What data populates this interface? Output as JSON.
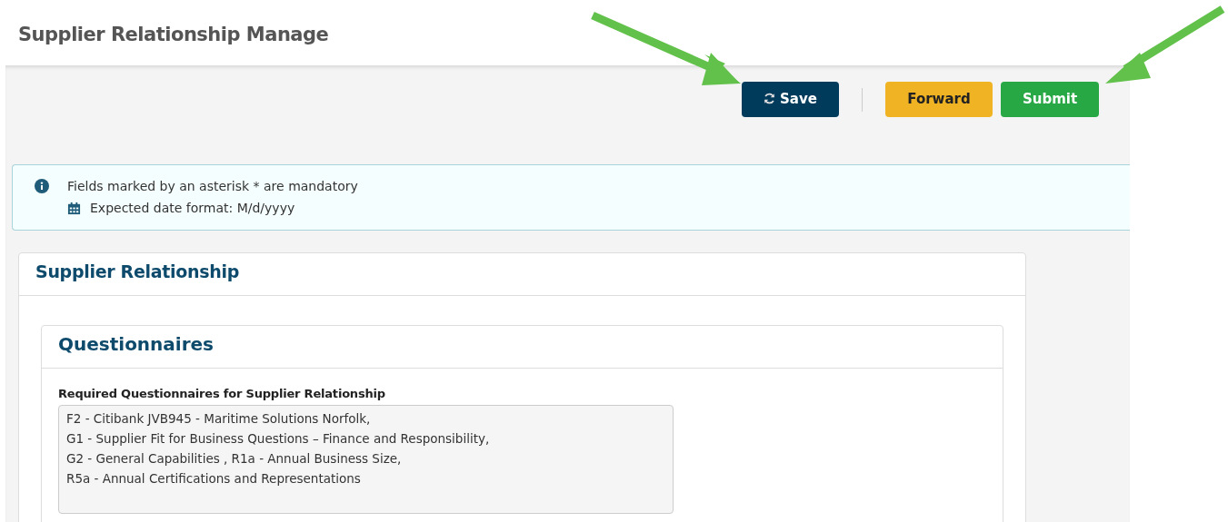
{
  "page": {
    "title": "Supplier Relationship Manage"
  },
  "toolbar": {
    "buttons": [
      {
        "label": "Save",
        "kind": "primary",
        "has_icon": true
      },
      {
        "label": "Forward",
        "kind": "warning",
        "has_icon": false
      },
      {
        "label": "Submit",
        "kind": "success",
        "has_icon": false
      }
    ]
  },
  "notice": {
    "lines": [
      {
        "text": "Fields marked by an asterisk * are mandatory",
        "kind": "info"
      },
      {
        "text": "Expected date format: M/d/yyyy",
        "kind": "calendar"
      }
    ]
  },
  "section": {
    "title": "Supplier Relationship",
    "panel": {
      "title": "Questionnaires",
      "field": {
        "label": "Required Questionnaires for Supplier Relationship",
        "value": "F2 - Citibank JVB945 - Maritime Solutions Norfolk,\nG1 - Supplier Fit for Business Questions – Finance and Responsibility,\nG2 - General Capabilities , R1a - Annual Business Size,\nR5a - Annual Certifications and Representations",
        "readonly": true
      }
    }
  }
}
